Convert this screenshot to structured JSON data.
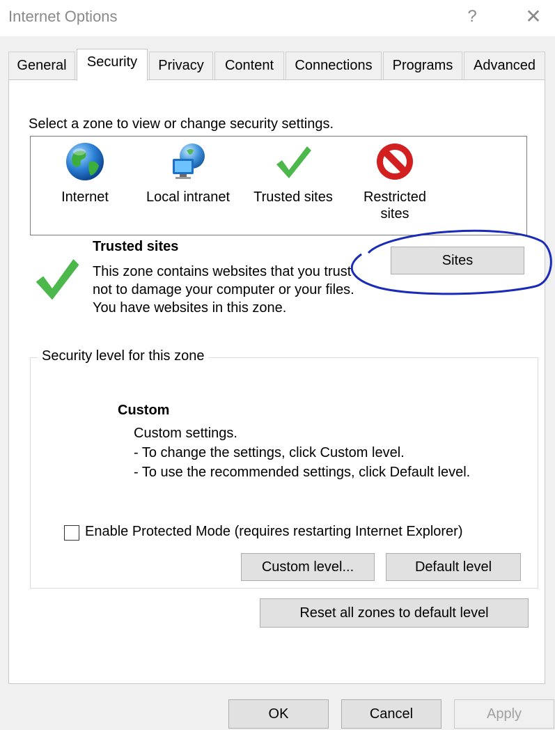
{
  "window": {
    "title": "Internet Options",
    "help": "?",
    "close": "✕"
  },
  "tabs": [
    {
      "label": "General"
    },
    {
      "label": "Security",
      "active": true
    },
    {
      "label": "Privacy"
    },
    {
      "label": "Content"
    },
    {
      "label": "Connections"
    },
    {
      "label": "Programs"
    },
    {
      "label": "Advanced"
    }
  ],
  "zones": {
    "prompt": "Select a zone to view or change security settings.",
    "items": [
      {
        "label": "Internet",
        "icon": "globe-icon"
      },
      {
        "label": "Local intranet",
        "icon": "intranet-icon"
      },
      {
        "label": "Trusted sites",
        "icon": "green-checkmark-icon",
        "selected": true
      },
      {
        "label": "Restricted\nsites",
        "icon": "restricted-icon"
      }
    ]
  },
  "zone_info": {
    "title": "Trusted sites",
    "lines": [
      "This zone contains websites that you trust not to damage your computer or your files.",
      "You have websites in this zone."
    ],
    "sites_button": "Sites"
  },
  "security_level": {
    "group_title": "Security level for this zone",
    "level_title": "Custom",
    "lines": [
      "Custom settings.",
      "- To change the settings, click Custom level.",
      "- To use the recommended settings, click Default level."
    ]
  },
  "protected_mode": {
    "label": "Enable Protected Mode (requires restarting Internet Explorer)",
    "checked": false
  },
  "buttons": {
    "custom_level": "Custom level...",
    "default_level": "Default level",
    "reset_all": "Reset all zones to default level",
    "ok": "OK",
    "cancel": "Cancel",
    "apply": "Apply"
  },
  "colors": {
    "annotation": "#1a2bb8",
    "check_green": "#4cb84c",
    "restricted_red": "#d21f1f"
  }
}
